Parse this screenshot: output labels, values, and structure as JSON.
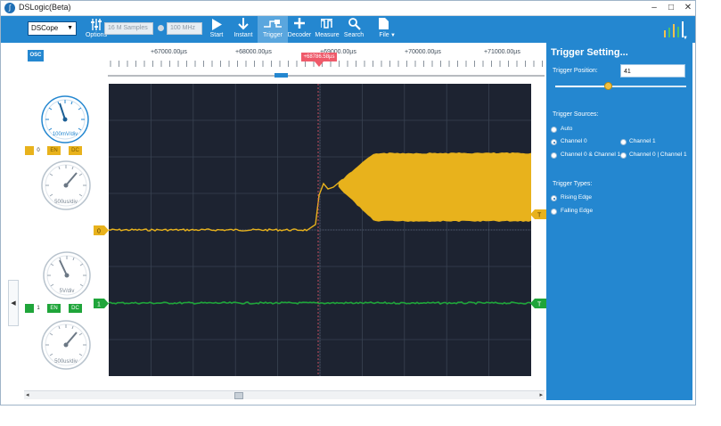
{
  "window": {
    "title": "DSLogic(Beta)",
    "minimize": "–",
    "maximize": "□",
    "close": "✕"
  },
  "toolbar": {
    "device": "DSCope",
    "options_label": "Options",
    "sample_count": "16 M Samples",
    "sample_rate": "100 MHz",
    "start_label": "Start",
    "instant_label": "Instant",
    "trigger_label": "Trigger",
    "decoder_label": "Decoder",
    "measure_label": "Measure",
    "search_label": "Search",
    "file_label": "File"
  },
  "left_panel": {
    "osc_label": "OSC",
    "channel0": {
      "index": "0",
      "en": "EN",
      "dc": "DC",
      "vdiv": "100mV/div",
      "tdiv": "500us/div",
      "color": "#e8b21c"
    },
    "channel1": {
      "index": "1",
      "en": "EN",
      "dc": "DC",
      "vdiv": "5V/div",
      "tdiv": "500us/div",
      "color": "#1fa53a"
    },
    "collapse_arrow": "◀"
  },
  "ruler": {
    "labels": [
      "+67000.00µs",
      "+68000.00µs",
      "+69000.00µs",
      "+70000.00µs",
      "+71000.00µs"
    ],
    "cursor": "+68786.58µs"
  },
  "scope": {
    "ch0_marker": "0",
    "ch1_marker": "1",
    "ch0_trig_marker": "T",
    "ch1_trig_marker": "T"
  },
  "scrollbar": {
    "left": "◂",
    "right": "▸"
  },
  "trigger_panel": {
    "title": "Trigger Setting...",
    "position_label": "Trigger Position:",
    "position_value": "41",
    "sources_label": "Trigger Sources:",
    "sources": [
      {
        "label": "Auto",
        "selected": false
      },
      {
        "label": "Channel 0",
        "selected": true
      },
      {
        "label": "Channel 1",
        "selected": false
      },
      {
        "label": "Channel 0 & Channel 1",
        "selected": false
      },
      {
        "label": "Channel 0 | Channel 1",
        "selected": false
      }
    ],
    "types_label": "Trigger Types:",
    "types": [
      {
        "label": "Rising Edge",
        "selected": true
      },
      {
        "label": "Falling Edge",
        "selected": false
      }
    ]
  },
  "colors": {
    "accent": "#2487d0",
    "ch0": "#e8b21c",
    "ch1": "#1fa53a",
    "cursor": "#ef5a6a",
    "scope_bg": "#1d2331"
  }
}
